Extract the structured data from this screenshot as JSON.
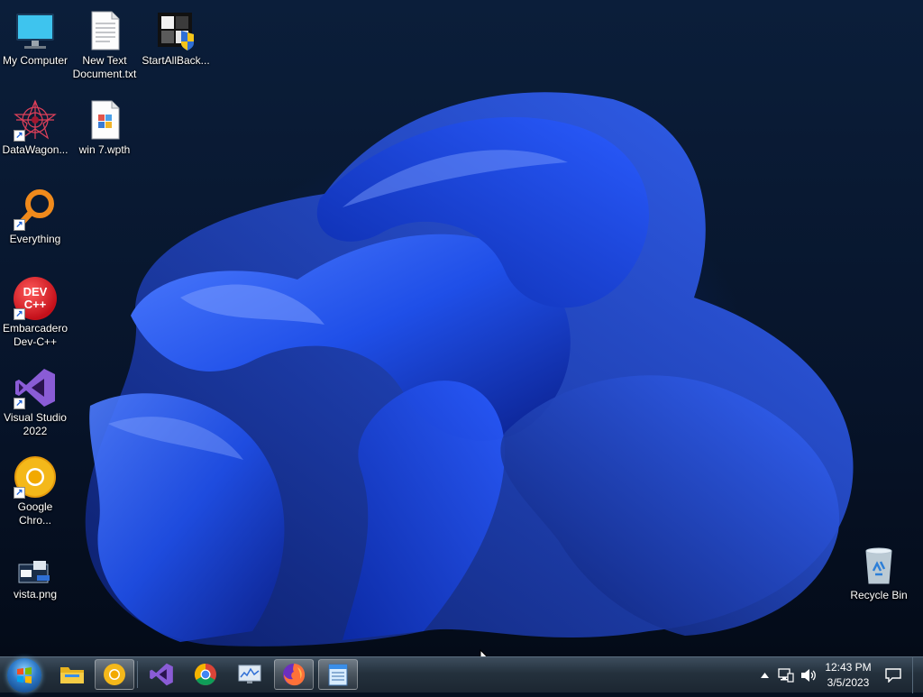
{
  "desktop": {
    "icons": [
      {
        "label": "My Computer",
        "icon": "monitor-icon"
      },
      {
        "label": "New Text Document.txt",
        "icon": "text-document-icon"
      },
      {
        "label": "StartAllBack...",
        "icon": "startallback-icon"
      },
      {
        "label": "DataWagon...",
        "icon": "datawagon-icon"
      },
      {
        "label": "win 7.wpth",
        "icon": "wpth-file-icon"
      },
      {
        "label": "Everything",
        "icon": "everything-search-icon"
      },
      {
        "label": "Embarcadero Dev-C++",
        "icon": "devcpp-icon",
        "badge": "DEV C++"
      },
      {
        "label": "Visual Studio 2022",
        "icon": "visual-studio-icon"
      },
      {
        "label": "Google Chro...",
        "icon": "chrome-canary-icon"
      },
      {
        "label": "vista.png",
        "icon": "image-file-icon"
      },
      {
        "label": "Recycle Bin",
        "icon": "recycle-bin-icon"
      }
    ]
  },
  "taskbar": {
    "pinned": [
      {
        "name": "file-explorer",
        "icon": "folder-icon"
      },
      {
        "name": "chrome-canary",
        "icon": "chrome-canary-icon",
        "active": true
      },
      {
        "name": "visual-studio",
        "icon": "visual-studio-icon"
      },
      {
        "name": "chrome",
        "icon": "chrome-icon"
      },
      {
        "name": "resource-monitor",
        "icon": "monitor-chart-icon"
      },
      {
        "name": "firefox",
        "icon": "firefox-icon",
        "active": true
      },
      {
        "name": "notepad",
        "icon": "notepad-icon",
        "active": true
      }
    ],
    "clock": {
      "time": "12:43 PM",
      "date": "3/5/2023"
    }
  },
  "colors": {
    "taskbar": "#24313d",
    "wallpaper_accent": "#1f4fe8"
  }
}
